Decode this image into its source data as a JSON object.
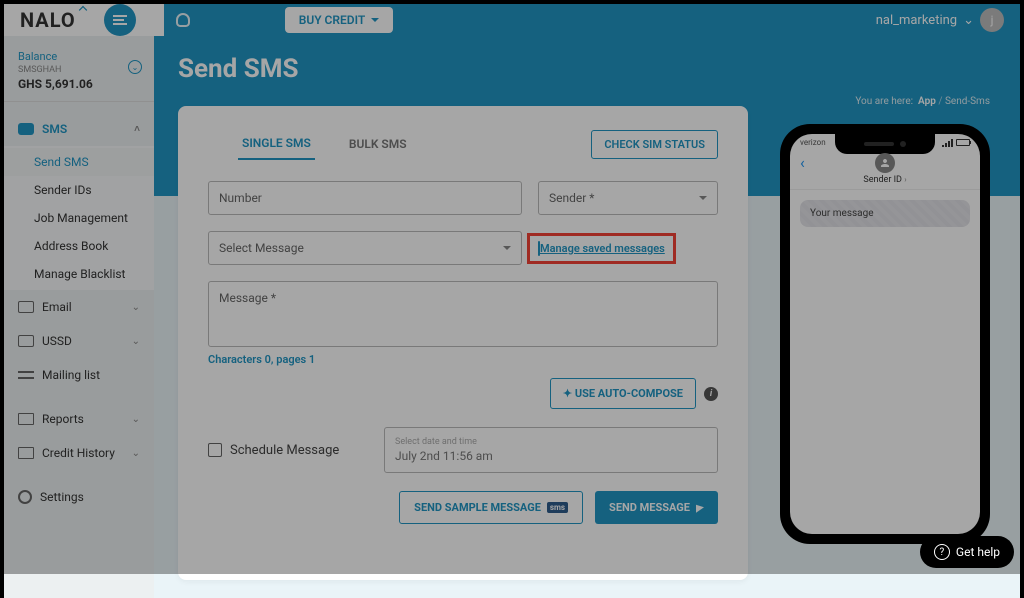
{
  "brand": {
    "name": "NALO"
  },
  "topbar": {
    "buy_credit": "BUY CREDIT",
    "user": "nal_marketing",
    "user_initial": "j"
  },
  "balance": {
    "label": "Balance",
    "account_label": "SMSGHAH",
    "amount": "GHS 5,691.06"
  },
  "nav": {
    "sms": {
      "label": "SMS",
      "items": [
        "Send SMS",
        "Sender IDs",
        "Job Management",
        "Address Book",
        "Manage Blacklist"
      ]
    },
    "email": "Email",
    "ussd": "USSD",
    "mailing": "Mailing list",
    "reports": "Reports",
    "credit": "Credit History",
    "settings": "Settings"
  },
  "page": {
    "title": "Send SMS",
    "breadcrumb": {
      "pre": "You are here:",
      "app": "App",
      "leaf": "Send-Sms"
    }
  },
  "tabs": {
    "single": "SINGLE SMS",
    "bulk": "BULK SMS",
    "check_sim": "CHECK SIM STATUS"
  },
  "form": {
    "number_ph": "Number",
    "sender_ph": "Sender *",
    "select_msg_ph": "Select Message",
    "manage_link": "Manage saved messages",
    "message_ph": "Message *",
    "chars_label": "Characters",
    "chars_val": "0",
    "pages_label": "pages",
    "pages_val": "1",
    "auto_compose": "USE AUTO-COMPOSE",
    "schedule_label": "Schedule Message",
    "date_hint": "Select date and time",
    "date_value": "July 2nd 11:56 am",
    "send_sample": "SEND SAMPLE MESSAGE",
    "send": "SEND MESSAGE"
  },
  "phone": {
    "carrier": "verizon",
    "sender_id": "Sender ID",
    "bubble": "Your message"
  },
  "help": {
    "label": "Get help"
  }
}
